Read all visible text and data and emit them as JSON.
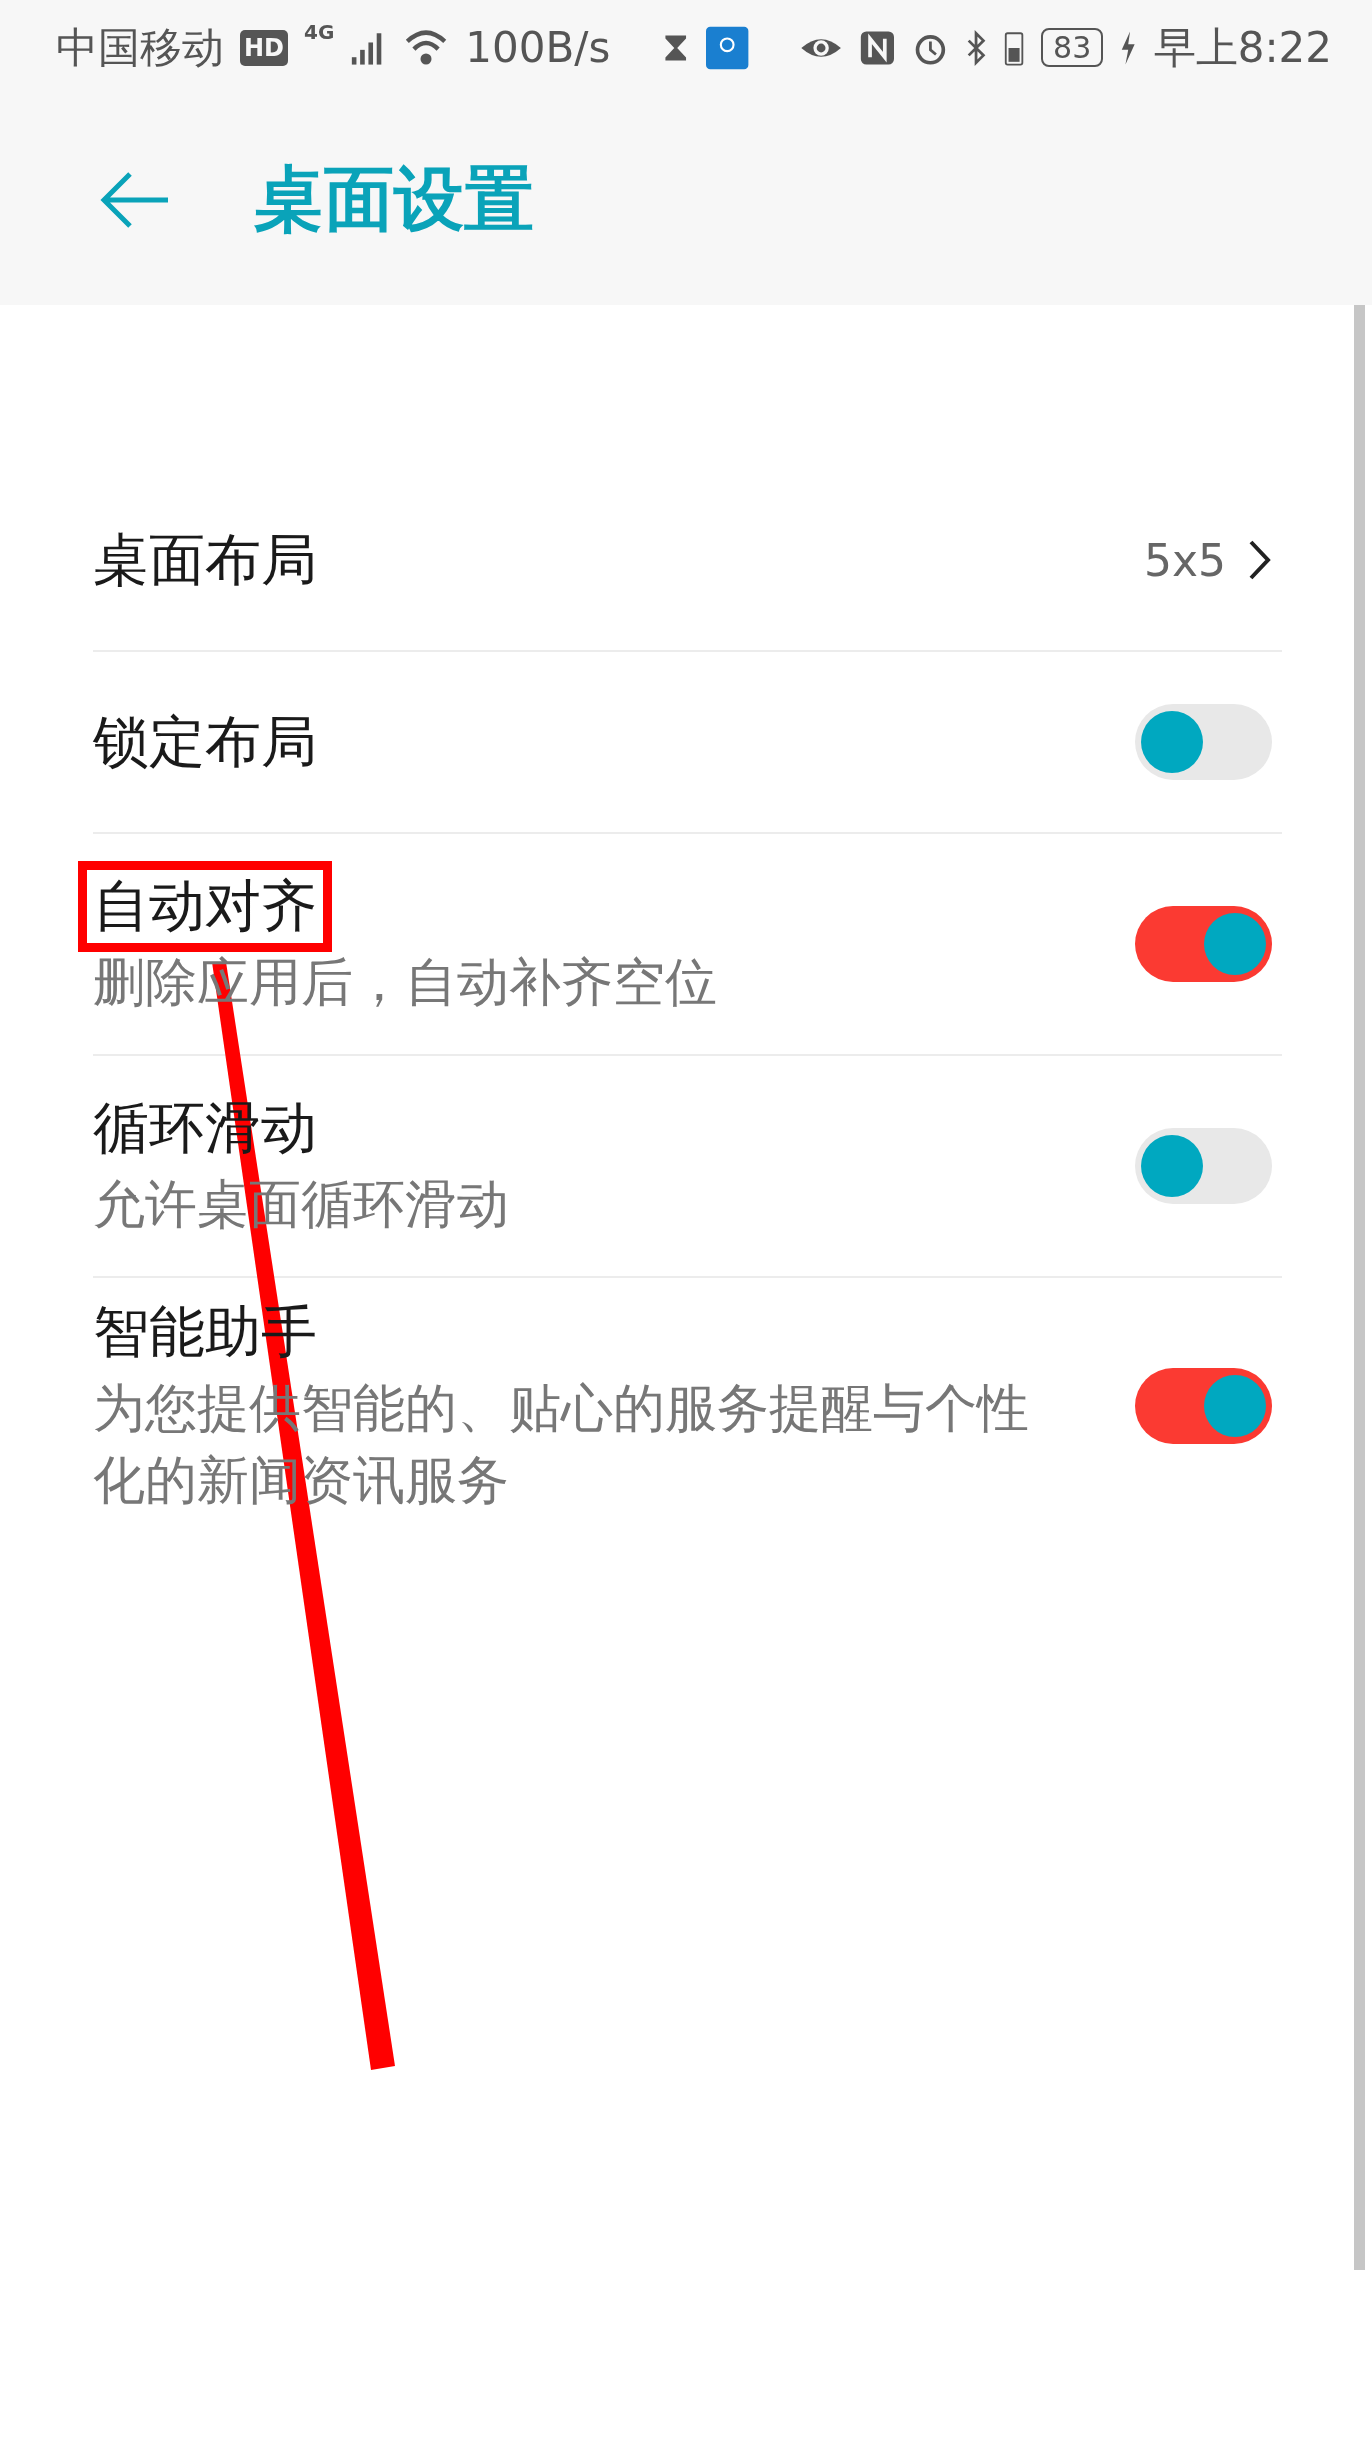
{
  "status_bar": {
    "carrier": "中国移动",
    "hd_badge": "HD",
    "network": "4G",
    "speed": "100B/s",
    "battery": "83",
    "time": "早上8:22"
  },
  "header": {
    "title": "桌面设置"
  },
  "settings": [
    {
      "kind": "value",
      "title": "桌面布局",
      "value": "5x5"
    },
    {
      "kind": "toggle",
      "title": "锁定布局",
      "on": false
    },
    {
      "kind": "toggle",
      "title": "自动对齐",
      "subtitle": "删除应用后，自动补齐空位",
      "on": true,
      "highlighted": true
    },
    {
      "kind": "toggle",
      "title": "循环滑动",
      "subtitle": "允许桌面循环滑动",
      "on": false
    },
    {
      "kind": "toggle",
      "title": "智能助手",
      "subtitle": "为您提供智能的、贴心的服务提醒与个性化的新闻资讯服务",
      "on": true
    }
  ]
}
